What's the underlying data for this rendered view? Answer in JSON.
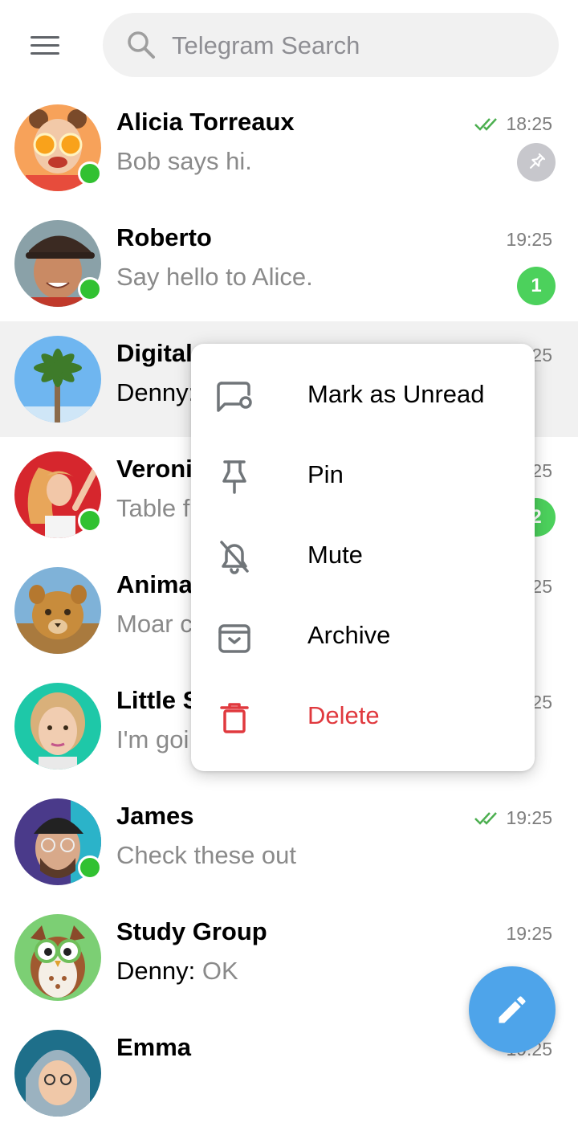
{
  "search": {
    "placeholder": "Telegram Search",
    "icon": "search-icon"
  },
  "header": {
    "menu_icon": "hamburger-menu-icon"
  },
  "colors": {
    "online": "#31c131",
    "unread_badge": "#4cd15c",
    "pinned_badge": "#c7c7cc",
    "read_ticks": "#4caf50",
    "fab": "#4ea4ea",
    "delete": "#e0393e",
    "highlight_row": "#f1f1f1"
  },
  "chats": [
    {
      "name": "Alicia Torreaux",
      "preview": "Bob says hi.",
      "time": "18:25",
      "read": true,
      "pinned": true,
      "online": true
    },
    {
      "name": "Roberto",
      "preview": "Say hello to Alice.",
      "time": "19:25",
      "unread": "1",
      "online": true
    },
    {
      "name": "Digital",
      "sender": "Denny:",
      "preview": "",
      "time": "25"
    },
    {
      "name": "Veronic",
      "preview": "Table f",
      "time": "25",
      "unread": "2",
      "online": true
    },
    {
      "name": "Animal",
      "preview": "Moar c",
      "time": "25"
    },
    {
      "name": "Little S",
      "preview": "I'm goi",
      "time": "25"
    },
    {
      "name": "James",
      "preview": "Check these out",
      "time": "19:25",
      "read": true,
      "online": true
    },
    {
      "name": "Study Group",
      "sender": "Denny:",
      "preview": " OK",
      "time": "19:25"
    },
    {
      "name": "Emma",
      "preview": "",
      "time": "19:25"
    }
  ],
  "context_menu": {
    "items": [
      {
        "label": "Mark as Unread",
        "icon": "mark-unread-icon"
      },
      {
        "label": "Pin",
        "icon": "pin-icon"
      },
      {
        "label": "Mute",
        "icon": "mute-bell-icon"
      },
      {
        "label": "Archive",
        "icon": "archive-icon"
      },
      {
        "label": "Delete",
        "icon": "trash-icon",
        "destructive": true
      }
    ]
  },
  "fab": {
    "icon": "pencil-icon"
  }
}
